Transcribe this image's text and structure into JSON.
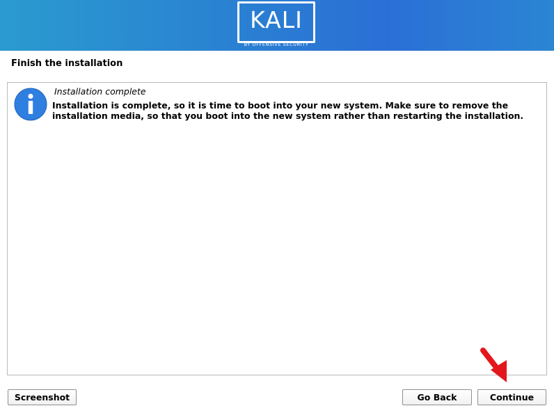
{
  "header": {
    "logo_text": "KALI",
    "logo_subtext": "BY OFFENSIVE SECURITY"
  },
  "page": {
    "title": "Finish the installation"
  },
  "message": {
    "icon": "info-icon",
    "title": "Installation complete",
    "body": "Installation is complete, so it is time to boot into your new system. Make sure to remove the installation media, so that you boot into the new system rather than restarting the installation."
  },
  "buttons": {
    "screenshot": "Screenshot",
    "go_back": "Go Back",
    "continue": "Continue"
  },
  "annotation": {
    "icon": "red-arrow-icon",
    "color": "#e3161c"
  },
  "colors": {
    "banner_start": "#2a9bcf",
    "banner_end": "#2b6fd6",
    "info_icon": "#2f7fe0"
  }
}
